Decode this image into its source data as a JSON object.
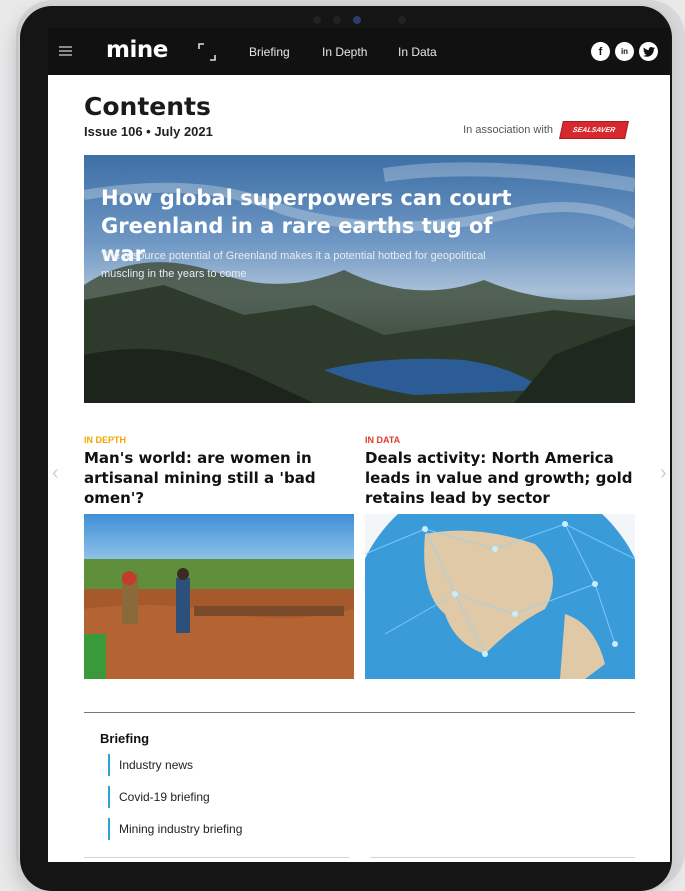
{
  "nav": {
    "logo": "mine",
    "links": [
      "Briefing",
      "In Depth",
      "In Data"
    ],
    "social": [
      "f",
      "in"
    ]
  },
  "page": {
    "title": "Contents",
    "issue": "Issue 106 • July 2021",
    "association": "In association with",
    "sponsor": "SEALSAVER"
  },
  "hero": {
    "title": "How global superpowers can court Greenland in a rare earths tug of war",
    "subtitle": "The resource potential of Greenland makes it a potential hotbed for geopolitical muscling in the years to come"
  },
  "cards": [
    {
      "category": "IN DEPTH",
      "category_color": "#f2a600",
      "headline": "Man's world: are women in artisanal mining still a 'bad omen'?"
    },
    {
      "category": "IN DATA",
      "category_color": "#e03a2f",
      "headline": "Deals activity: North America leads in value and growth; gold retains lead by sector"
    }
  ],
  "briefing": {
    "title": "Briefing",
    "items": [
      "Industry news",
      "Covid-19 briefing",
      "Mining industry briefing"
    ]
  },
  "colors": {
    "accent": "#2aa5d9",
    "nav_bg": "#111111"
  }
}
